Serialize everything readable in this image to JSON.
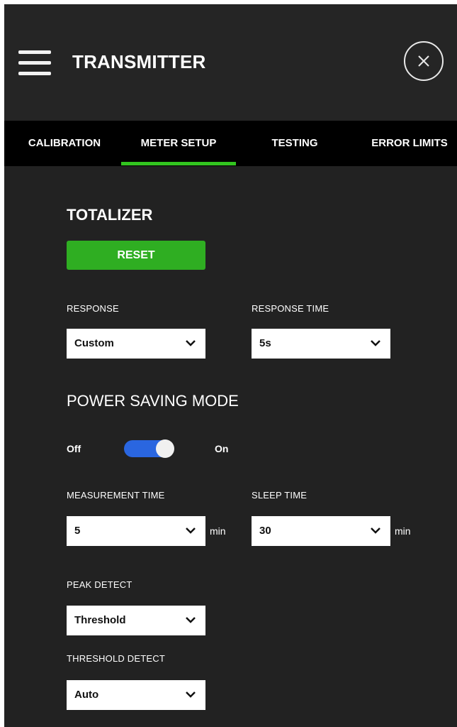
{
  "header": {
    "title": "TRANSMITTER"
  },
  "tabs": [
    {
      "label": "CALIBRATION"
    },
    {
      "label": "METER SETUP",
      "active": true
    },
    {
      "label": "TESTING"
    },
    {
      "label": "ERROR LIMITS"
    }
  ],
  "totalizer": {
    "title": "TOTALIZER",
    "reset_label": "RESET"
  },
  "response": {
    "label": "RESPONSE",
    "value": "Custom"
  },
  "response_time": {
    "label": "RESPONSE TIME",
    "value": "5s"
  },
  "power_saving": {
    "title": "POWER SAVING MODE",
    "off_label": "Off",
    "on_label": "On",
    "enabled": true
  },
  "measurement_time": {
    "label": "MEASUREMENT TIME",
    "value": "5",
    "unit": "min"
  },
  "sleep_time": {
    "label": "SLEEP TIME",
    "value": "30",
    "unit": "min"
  },
  "peak_detect": {
    "label": "PEAK DETECT",
    "value": "Threshold"
  },
  "threshold_detect": {
    "label": "THRESHOLD DETECT",
    "value": "Auto"
  },
  "colors": {
    "accent_green": "#32c51f",
    "button_green": "#2fae22",
    "toggle_blue": "#2a66e0",
    "background": "#222222"
  },
  "icons": {
    "menu": "hamburger-icon",
    "close": "close-icon",
    "dropdown": "chevron-down-icon"
  }
}
